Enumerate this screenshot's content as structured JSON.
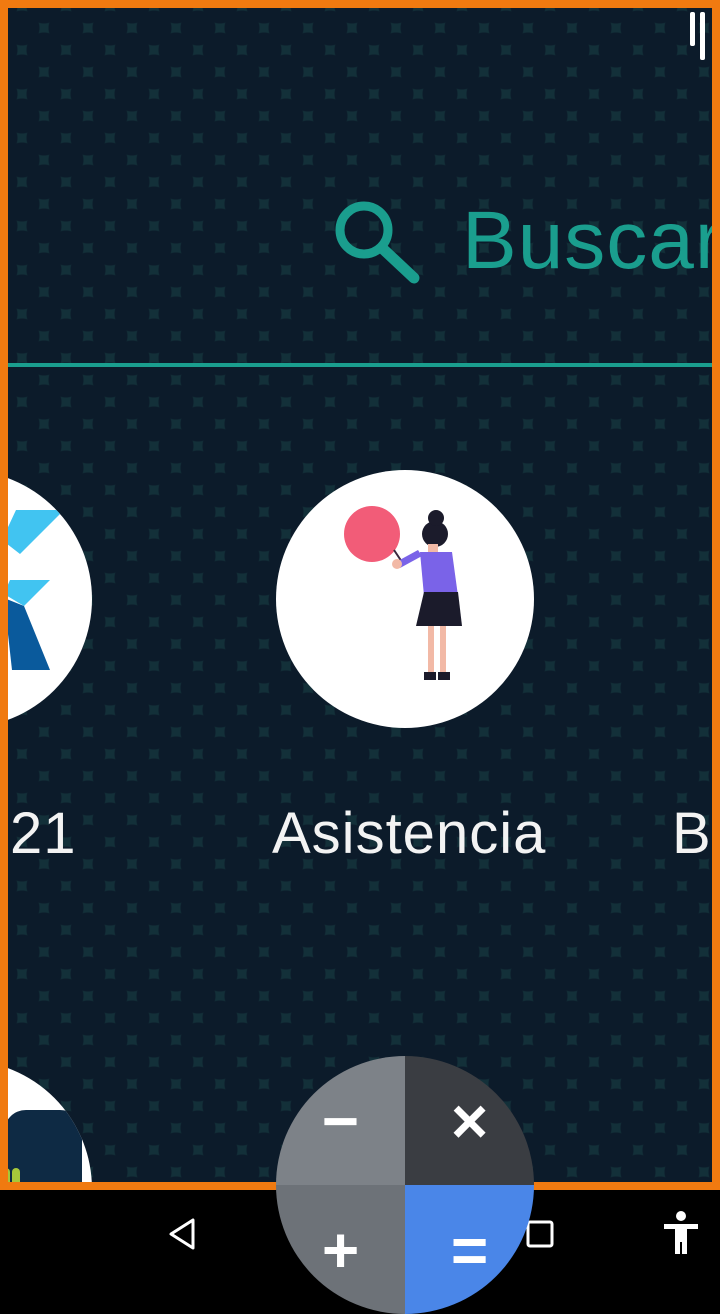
{
  "search": {
    "label": "Buscar",
    "icon": "search-icon",
    "color": "#1a9e8e"
  },
  "apps": [
    {
      "label": "21",
      "icon": "flutter-logo-icon"
    },
    {
      "label": "Asistencia",
      "icon": "woman-with-balloon-icon"
    },
    {
      "label": "Ba",
      "icon": "app-icon"
    }
  ],
  "bottom_app": {
    "icon": "app-icon"
  },
  "fab": {
    "icon": "calculator-icon",
    "keys": [
      "−",
      "×",
      "+",
      "="
    ]
  },
  "navbar": {
    "back_icon": "back-icon",
    "home_icon": "home-icon",
    "recents_icon": "recents-icon",
    "accessibility_icon": "accessibility-icon"
  },
  "colors": {
    "frame": "#f07a10",
    "accent": "#1a9e8e",
    "background": "#133039"
  }
}
